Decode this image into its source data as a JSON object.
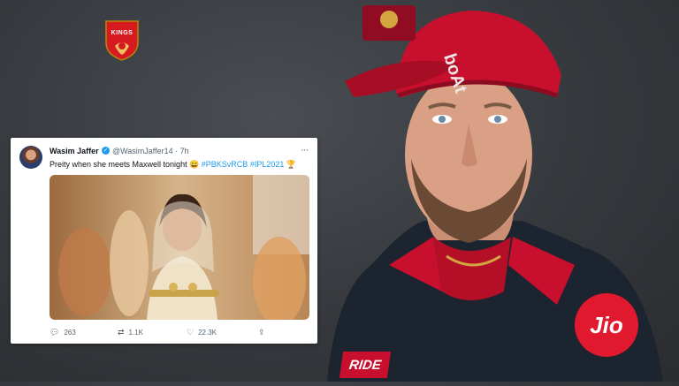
{
  "background": {
    "team_logo": {
      "text": "KINGS",
      "icon": "punjab-kings-lion-shield-icon"
    },
    "cap_brand": "boAt",
    "jersey_sponsor_badge": "Jio",
    "jersey_side_sponsor": "RIDE"
  },
  "tweet": {
    "author_name": "Wasim Jaffer",
    "verified_icon": "verified-badge-icon",
    "handle_time": "@WasimJaffer14 · 7h",
    "text_plain": "Preity when she meets Maxwell tonight 😄 ",
    "hashtag_1": "#PBKSvRCB",
    "hashtag_2": "#IPL2021",
    "trophy_emoji": "🏆",
    "media_alt_icon": "photo-media",
    "replies": "263",
    "retweets": "1.1K",
    "likes": "22.3K"
  },
  "colors": {
    "twitter_blue": "#1d9bf0",
    "rcb_red": "#c8102e",
    "jio_red": "#e1192e"
  }
}
